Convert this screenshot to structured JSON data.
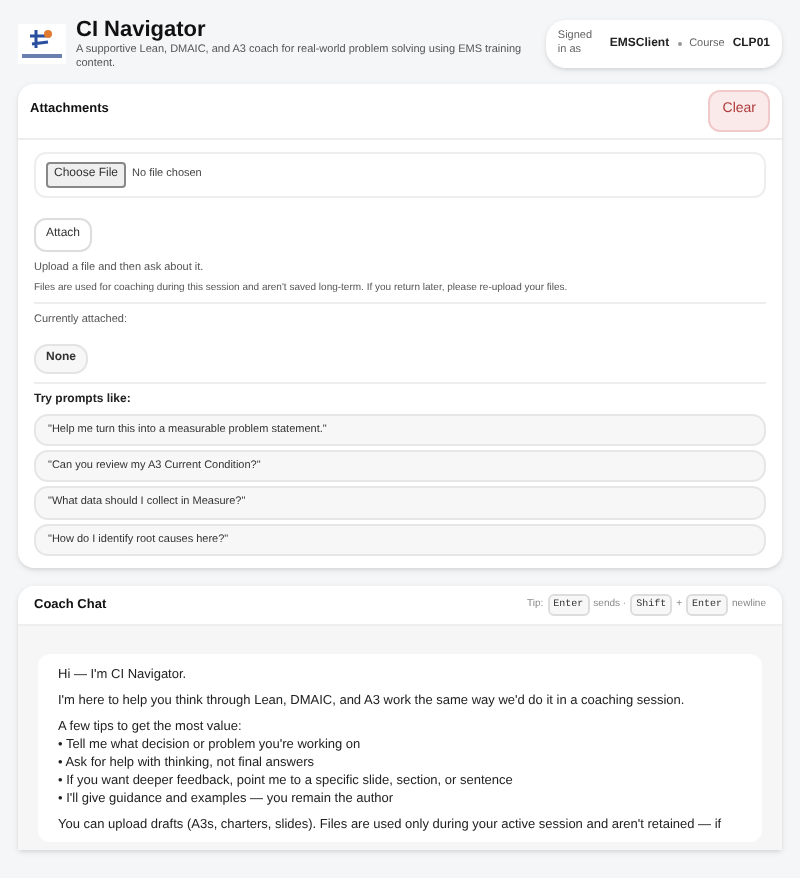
{
  "header": {
    "title": "CI Navigator",
    "subtitle": "A supportive Lean, DMAIC, and A3 coach for real-world problem solving using EMS training content.",
    "signed_in_label": "Signed in as",
    "user": "EMSClient",
    "course_label": "Course",
    "course": "CLP01"
  },
  "attachments": {
    "title": "Attachments",
    "clear_button": "Clear",
    "file_button": "Choose File",
    "file_status": "No file chosen",
    "attach_button": "Attach",
    "help": "Upload a file and then ask about it.",
    "notice": "Files are used for coaching during this session and aren't saved long-term. If you return later, please re-upload your files.",
    "currently_label": "Currently attached:",
    "current": "None",
    "prompts_label": "Try prompts like:",
    "prompts": [
      "\"Help me turn this into a measurable problem statement.\"",
      "\"Can you review my A3 Current Condition?\"",
      "\"What data should I collect in Measure?\"",
      "\"How do I identify root causes here?\""
    ]
  },
  "chat": {
    "title": "Coach Chat",
    "tip": [
      {
        "kind": "text",
        "text": "Tip:"
      },
      {
        "kind": "key",
        "text": "Enter"
      },
      {
        "kind": "text",
        "text": "sends ·"
      },
      {
        "kind": "key",
        "text": "Shift"
      },
      {
        "kind": "text",
        "text": "+"
      },
      {
        "kind": "key",
        "text": "Enter"
      },
      {
        "kind": "text",
        "text": "newline"
      }
    ],
    "message": {
      "greeting": "Hi — I'm CI Navigator.",
      "intro": "I'm here to help you think through Lean, DMAIC, and A3 work the same way we'd do it in a coaching session.",
      "tips_label": "A few tips to get the most value:",
      "tips": [
        "• Tell me what decision or problem you're working on",
        "• Ask for help with thinking, not final answers",
        "• If you want deeper feedback, point me to a specific slide, section, or sentence",
        "• I'll give guidance and examples — you remain the author"
      ],
      "upload_note": "You can upload drafts (A3s, charters, slides). Files are used only during your active session and aren't retained — if"
    }
  }
}
